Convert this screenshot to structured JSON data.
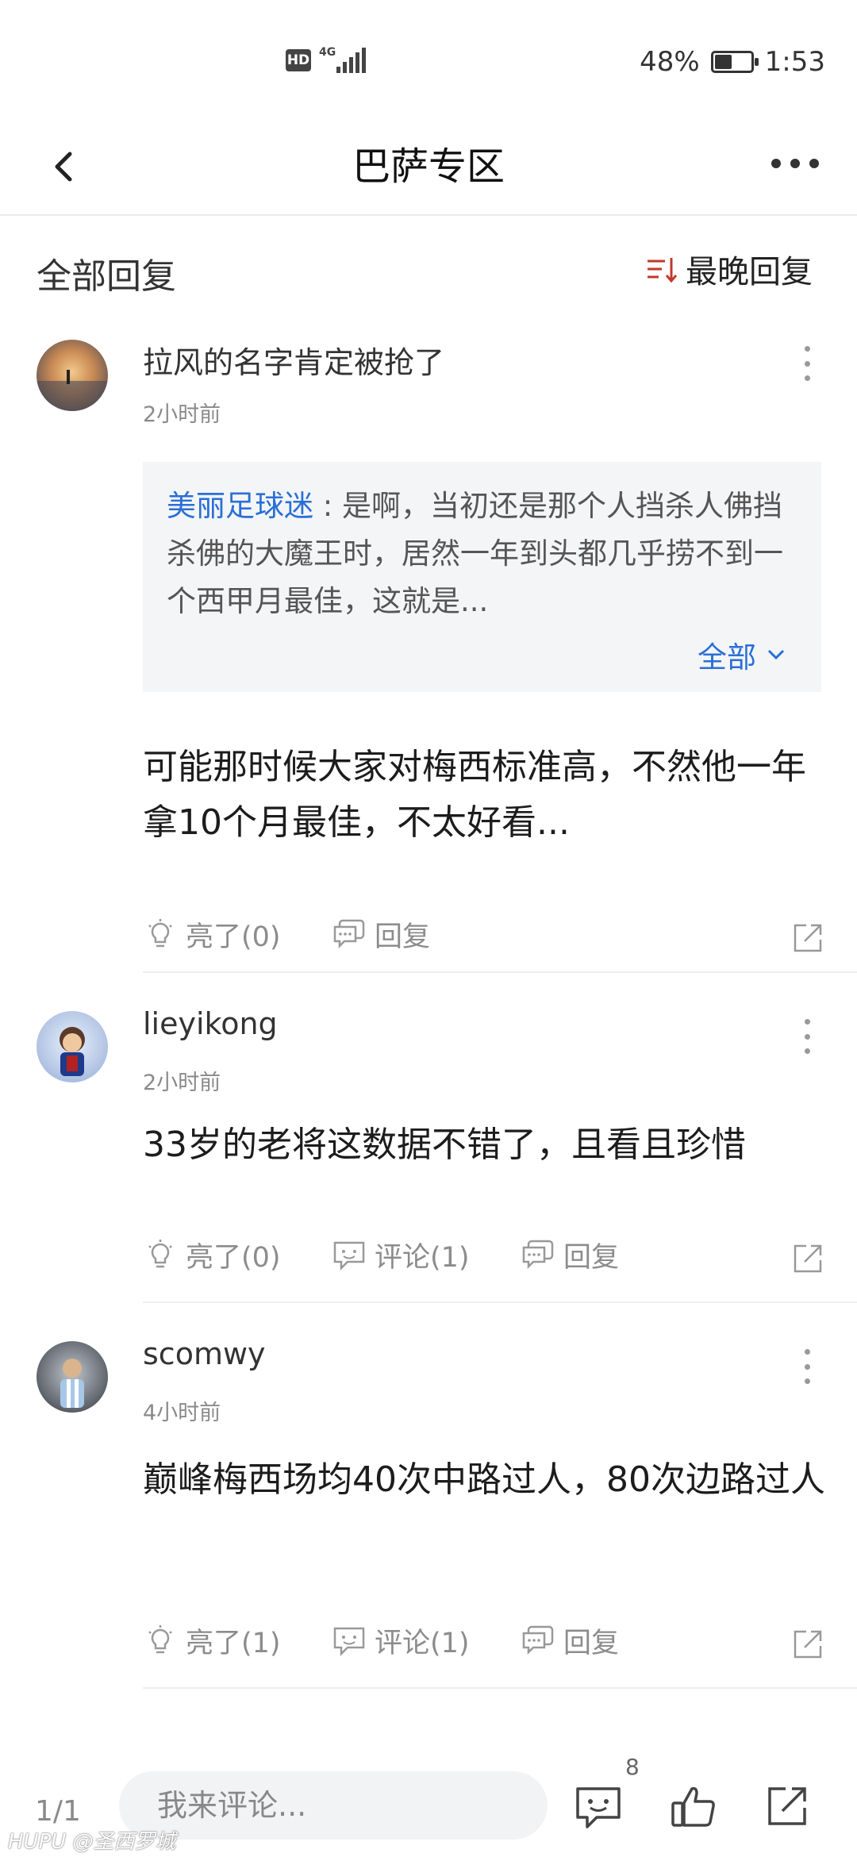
{
  "status": {
    "hd": "HD",
    "network": "4G",
    "battery_pct": "48%",
    "battery_level": 0.48,
    "time": "1:53"
  },
  "header": {
    "title": "巴萨专区"
  },
  "sortbar": {
    "all_replies": "全部回复",
    "sort_label": "最晚回复"
  },
  "comments": [
    {
      "username": "拉风的名字肯定被抢了",
      "time": "2小时前",
      "quote": {
        "user": "美丽足球迷",
        "separator": ":",
        "text": "是啊，当初还是那个人挡杀人佛挡杀佛的大魔王时，居然一年到头都几乎捞不到一个西甲月最佳，这就是...",
        "expand_label": "全部"
      },
      "body": "可能那时候大家对梅西标准高，不然他一年拿10个月最佳，不太好看...",
      "like_label": "亮了(0)",
      "reply_label": "回复"
    },
    {
      "username": "lieyikong",
      "time": "2小时前",
      "body": "33岁的老将这数据不错了，且看且珍惜",
      "like_label": "亮了(0)",
      "comment_label": "评论(1)",
      "reply_label": "回复"
    },
    {
      "username": "scomwy",
      "time": "4小时前",
      "body": "巅峰梅西场均40次中路过人，80次边路过人",
      "like_label": "亮了(1)",
      "comment_label": "评论(1)",
      "reply_label": "回复"
    }
  ],
  "bottom": {
    "page": "1/1",
    "input_placeholder": "我来评论...",
    "comment_count": "8"
  },
  "watermark": "HUPU @圣西罗城",
  "colors": {
    "link": "#2a6fd6",
    "sort_icon": "#c0392b",
    "muted": "#8c8c8c"
  }
}
